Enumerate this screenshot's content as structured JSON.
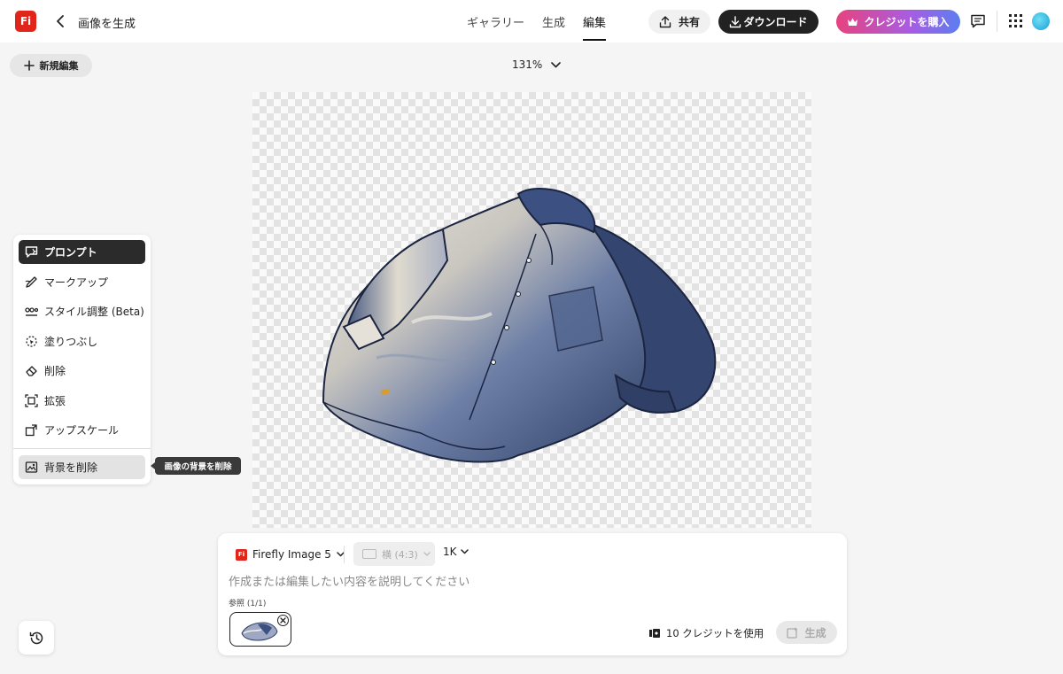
{
  "app": {
    "logo_text": "Fi",
    "page_title": "画像を生成"
  },
  "header": {
    "tabs": [
      {
        "label": "ギャラリー",
        "active": false
      },
      {
        "label": "生成",
        "active": false
      },
      {
        "label": "編集",
        "active": true
      }
    ],
    "share_label": "共有",
    "download_label": "ダウンロード",
    "buy_credits_label": "クレジットを購入",
    "icons": {
      "back": "chevron-left-icon",
      "share": "upload-icon",
      "download": "download-icon",
      "crown": "crown-icon",
      "feedback": "comment-icon",
      "apps": "grid-icon"
    }
  },
  "toolbar": {
    "new_edit_label": "新規編集",
    "zoom_level": "131%"
  },
  "tools": {
    "items": [
      {
        "label": "プロンプト",
        "icon": "prompt-icon",
        "state": "active"
      },
      {
        "label": "マークアップ",
        "icon": "markup-icon",
        "state": "normal"
      },
      {
        "label": "スタイル調整 (Beta)",
        "icon": "style-adjust-icon",
        "state": "normal"
      },
      {
        "label": "塗りつぶし",
        "icon": "fill-icon",
        "state": "normal"
      },
      {
        "label": "削除",
        "icon": "erase-icon",
        "state": "normal"
      },
      {
        "label": "拡張",
        "icon": "expand-icon",
        "state": "normal"
      },
      {
        "label": "アップスケール",
        "icon": "upscale-icon",
        "state": "normal"
      },
      {
        "label": "背景を削除",
        "icon": "remove-background-icon",
        "state": "hover"
      }
    ],
    "tooltip": "画像の背景を削除"
  },
  "prompt_panel": {
    "model_logo": "Fi",
    "model": "Firefly Image 5",
    "aspect_ratio": "横 (4:3)",
    "resolution": "1K",
    "placeholder": "作成または編集したい内容を説明してください",
    "reference_label": "参照 (1/1)",
    "credits_text": "10 クレジットを使用",
    "generate_label": "生成"
  },
  "colors": {
    "brand_red": "#e1251b",
    "dark_button": "#222222",
    "credit_gradient_start": "#e8427e",
    "credit_gradient_end": "#5b7ef0"
  }
}
